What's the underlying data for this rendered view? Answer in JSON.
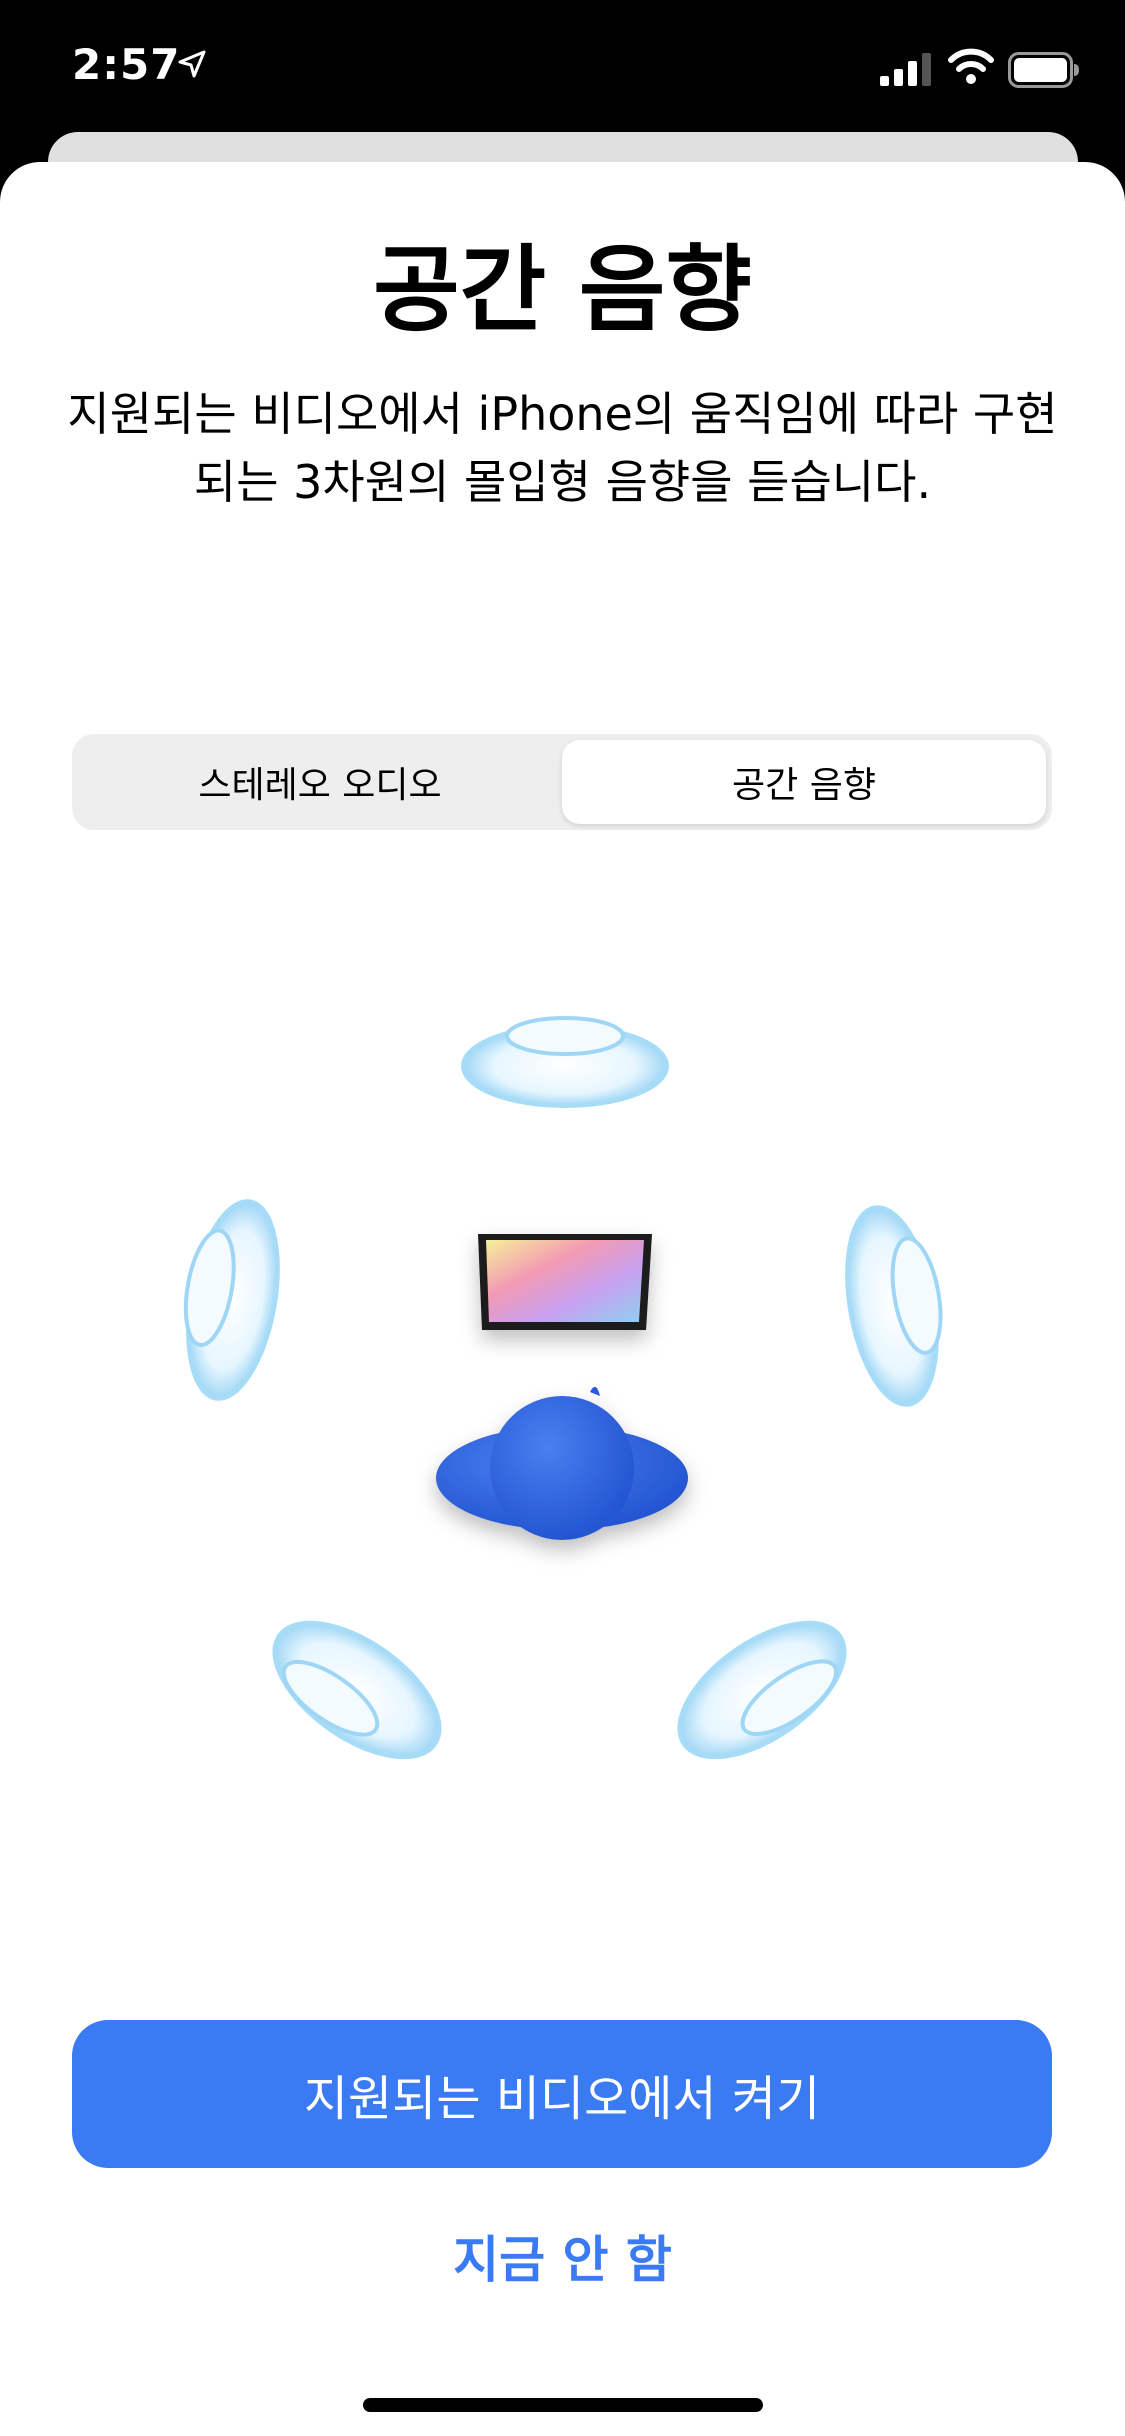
{
  "status_bar": {
    "time": "2:57",
    "icons": [
      "location-arrow-icon",
      "cellular-signal-icon",
      "wifi-icon",
      "battery-icon"
    ]
  },
  "sheet": {
    "title": "공간 음향",
    "description": "지원되는 비디오에서 iPhone의 움직임에 따라 구현되는 3차원의 몰입형 음향을 듣습니다.",
    "segments": [
      {
        "label": "스테레오 오디오",
        "selected": false
      },
      {
        "label": "공간 음향",
        "selected": true
      }
    ],
    "primary_button": "지원되는 비디오에서 켜기",
    "secondary_button": "지금 안 함"
  },
  "colors": {
    "accent": "#3a7af2",
    "speaker": "#bfe6fb",
    "head": "#2f63dc"
  }
}
